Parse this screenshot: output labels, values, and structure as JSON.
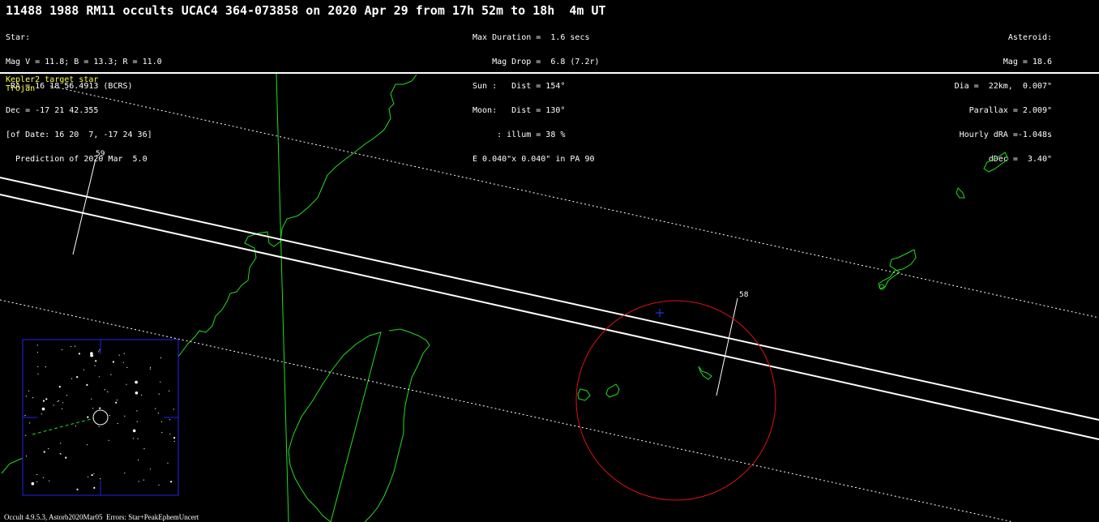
{
  "title": "11488 1988 RM11 occults UCAC4 364-073858 on 2020 Apr 29 from 17h 52m to 18h  4m UT",
  "header_left": [
    "Star:",
    "Mag V = 11.8; B = 13.3; R = 11.0",
    " RA = 16 18 56.4913 (BCRS)",
    "Dec = -17 21 42.355",
    "[of Date: 16 20  7, -17 24 36]",
    "  Prediction of 2020 Mar  5.0"
  ],
  "header_mid": [
    "Max Duration =  1.6 secs",
    "    Mag Drop =  6.8 (7.2r)",
    "Sun :   Dist = 154°",
    "Moon:   Dist = 130°",
    "     : illum = 38 %",
    "E 0.040\"x 0.040\" in PA 90"
  ],
  "header_right": [
    "Asteroid:",
    "Mag = 18.6",
    "Dia =  22km,  0.007\"",
    "Parallax = 2.009\"",
    "Hourly dRA =-1.048s",
    "dDec =  3.40\""
  ],
  "tags": [
    "Kepler2 target star",
    "Trojan"
  ],
  "site_labels": [
    "59",
    "58"
  ],
  "footer": "Occult 4.9.5.3, Astorb2020Mar05  Errors: Star+PeakEphemUncert",
  "colors": {
    "background": "#000000",
    "coastline": "#22dd22",
    "path": "#ffffff",
    "error_circle": "#dd1111",
    "star_chart_frame": "#2222ee",
    "tag_text": "#ffff40"
  },
  "icons": [
    "error-ellipse-icon",
    "center-cross-icon",
    "target-star-circle-icon"
  ]
}
